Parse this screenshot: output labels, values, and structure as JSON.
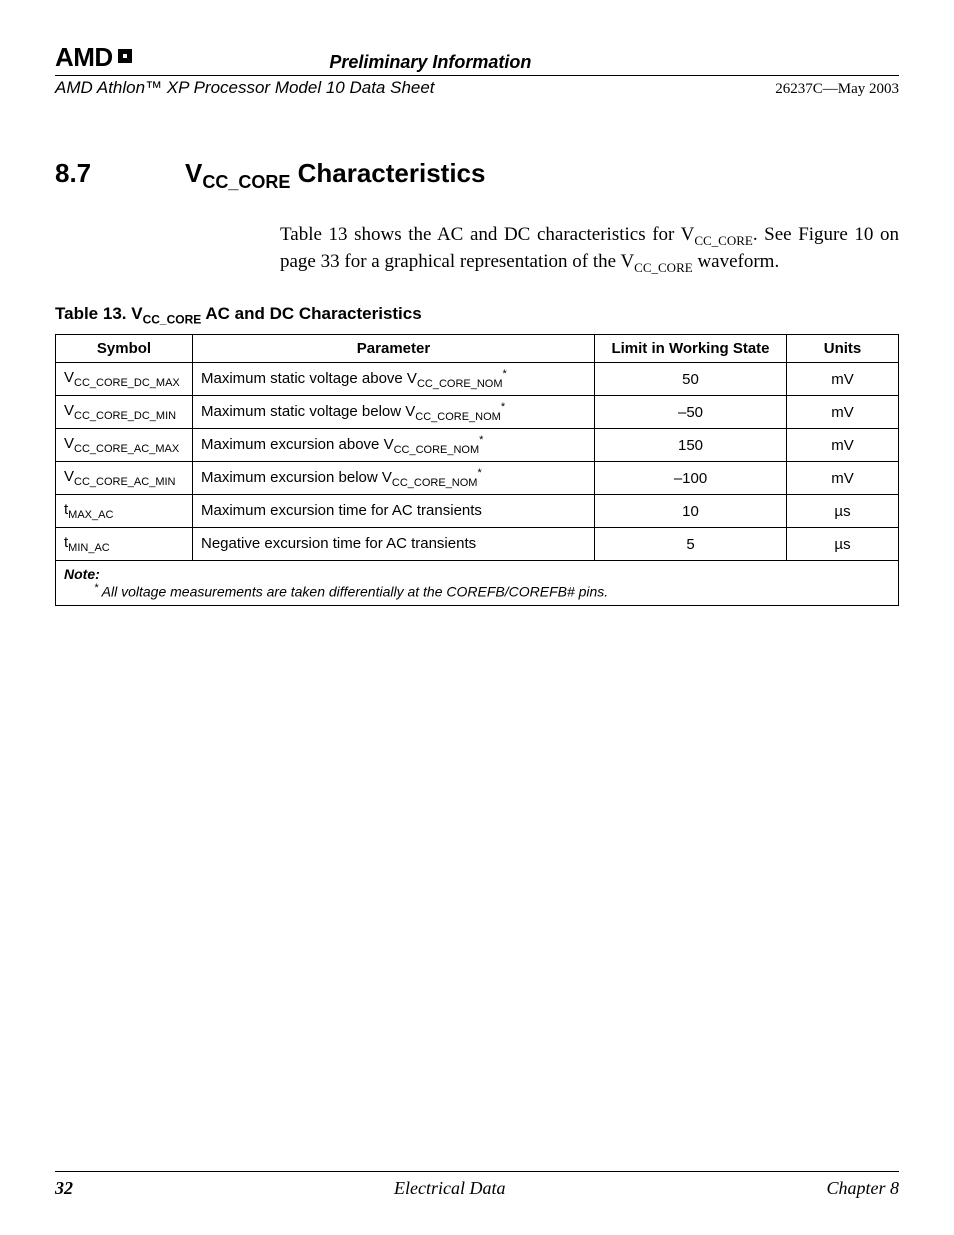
{
  "header": {
    "logo_text": "AMD",
    "preliminary": "Preliminary Information",
    "doc_id": "26237C—May 2003",
    "doc_title": "AMD Athlon™ XP Processor Model 10 Data Sheet"
  },
  "section": {
    "number": "8.7",
    "title_prefix": "V",
    "title_sub": "CC_CORE",
    "title_suffix": " Characteristics",
    "body_1a": "Table 13 shows the AC and DC characteristics for V",
    "body_1sub": "CC_CORE",
    "body_1b": ". See Figure 10 on page 33 for a graphical representation of the V",
    "body_2sub": "CC_CORE",
    "body_1c": " waveform."
  },
  "table": {
    "caption_prefix": "Table 13.   V",
    "caption_sub": "CC_CORE",
    "caption_suffix": " AC and DC Characteristics",
    "headers": {
      "symbol": "Symbol",
      "parameter": "Parameter",
      "limit": "Limit in Working State",
      "units": "Units"
    },
    "rows": [
      {
        "sym_main": "V",
        "sym_sub": "CC_CORE_DC_MAX",
        "param_main": "Maximum static voltage above V",
        "param_sub": "CC_CORE_NOM",
        "param_star": "*",
        "limit": "50",
        "units": "mV"
      },
      {
        "sym_main": "V",
        "sym_sub": "CC_CORE_DC_MIN",
        "param_main": "Maximum static voltage below V",
        "param_sub": "CC_CORE_NOM",
        "param_star": "*",
        "limit": "–50",
        "units": "mV"
      },
      {
        "sym_main": "V",
        "sym_sub": "CC_CORE_AC_MAX",
        "param_main": "Maximum excursion above V",
        "param_sub": "CC_CORE_NOM",
        "param_star": "*",
        "limit": "150",
        "units": "mV"
      },
      {
        "sym_main": "V",
        "sym_sub": "CC_CORE_AC_MIN",
        "param_main": "Maximum excursion below V",
        "param_sub": "CC_CORE_NOM",
        "param_star": "*",
        "limit": "–100",
        "units": "mV"
      },
      {
        "sym_main": "t",
        "sym_sub": "MAX_AC",
        "param_main": "Maximum excursion time for AC transients",
        "param_sub": "",
        "param_star": "",
        "limit": "10",
        "units": "µs"
      },
      {
        "sym_main": "t",
        "sym_sub": "MIN_AC",
        "param_main": "Negative excursion time for AC transients",
        "param_sub": "",
        "param_star": "",
        "limit": "5",
        "units": "µs"
      }
    ],
    "note_label": "Note:",
    "note_star": "*",
    "note_text": " All voltage measurements are taken differentially at the COREFB/COREFB# pins."
  },
  "footer": {
    "page_num": "32",
    "center": "Electrical Data",
    "right": "Chapter 8"
  }
}
